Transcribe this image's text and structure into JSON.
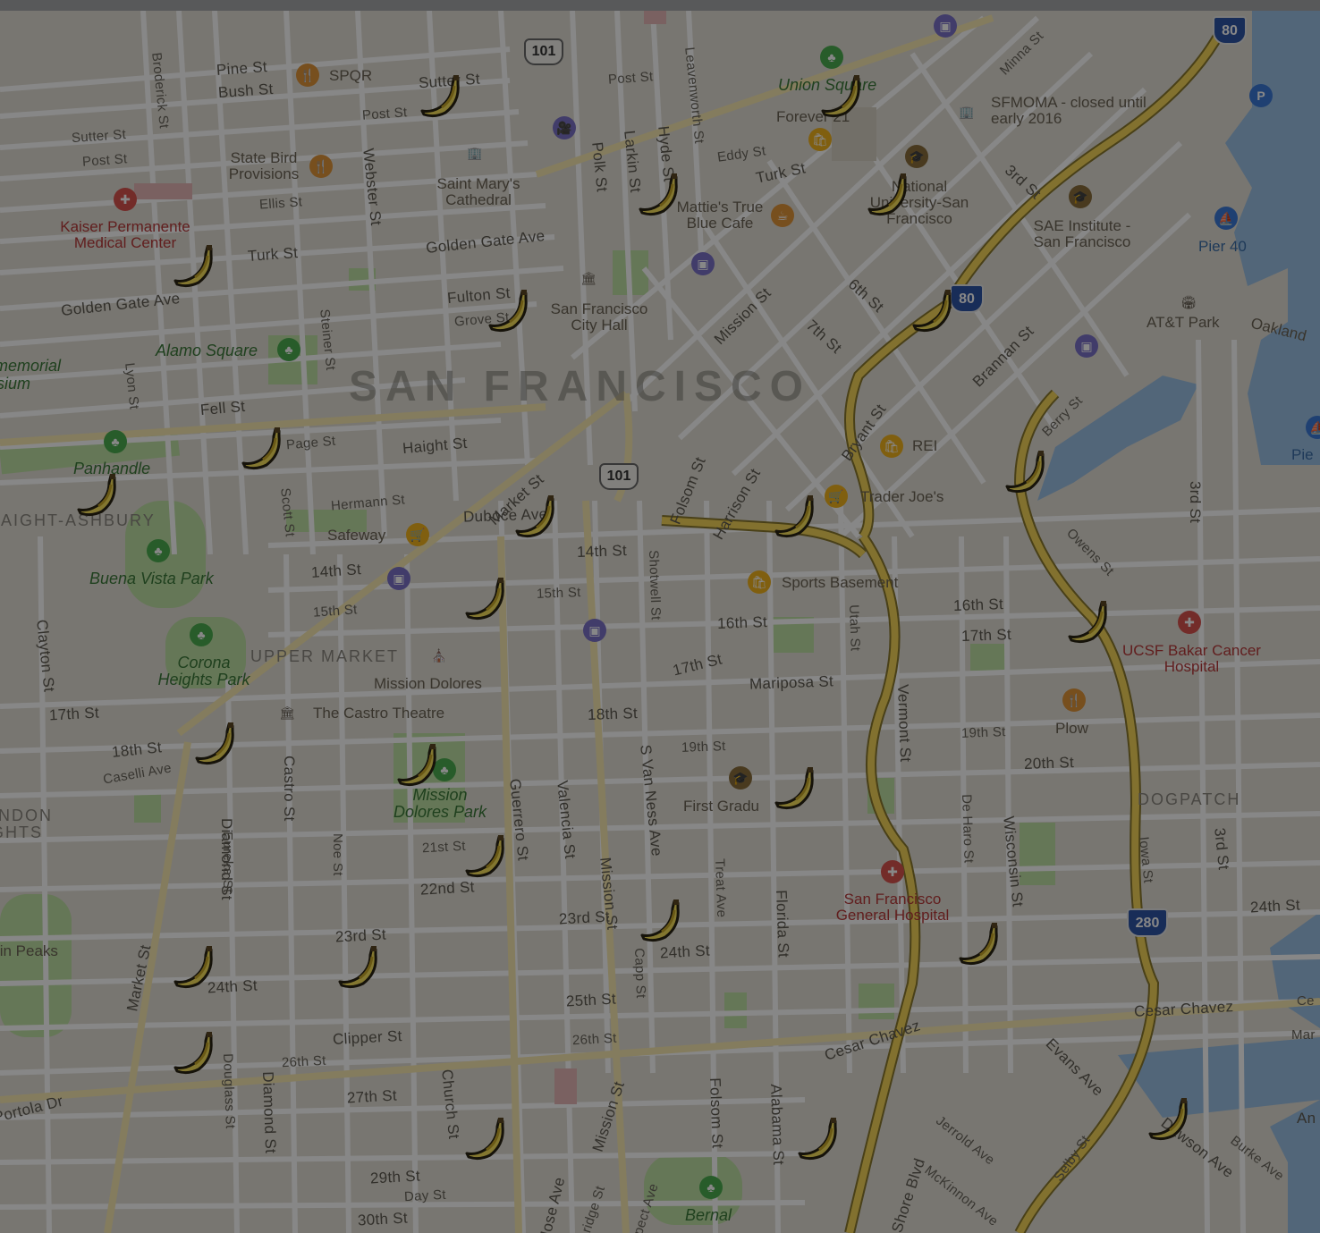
{
  "map": {
    "city_label": "SAN FRANCISCO",
    "colors": {
      "land": "#e3dfd6",
      "water": "#9cc0e4",
      "park": "#bfe0a4",
      "street": "#ffffff",
      "highway": "#f6d65a",
      "overlay": "rgba(0,0,0,0.47)"
    },
    "street_labels": [
      "Pine St",
      "Bush St",
      "Sutter St",
      "Post St",
      "Ellis St",
      "Turk St",
      "Golden Gate Ave",
      "Fell St",
      "Page St",
      "Haight St",
      "Hermann St",
      "14th St",
      "15th St",
      "17th St",
      "18th St",
      "Caselli Ave",
      "Diamond St",
      "Eureka St",
      "Castro St",
      "Noe St",
      "21st St",
      "22nd St",
      "23rd St",
      "24th St",
      "25th St",
      "26th St",
      "27th St",
      "29th St",
      "30th St",
      "Day St",
      "Clipper St",
      "Market St",
      "Duboce Ave",
      "16th St",
      "Mariposa St",
      "19th St",
      "20th St",
      "Cesar Chavez",
      "Broderick St",
      "Webster St",
      "Polk St",
      "Larkin St",
      "Hyde St",
      "Leavenworth St",
      "Eddy St",
      "Minna St",
      "Fulton St",
      "Grove St",
      "Mission St",
      "6th St",
      "7th St",
      "Brannan St",
      "Bryant St",
      "Berry St",
      "3rd St",
      "Harrison St",
      "Folsom St",
      "Shotwell St",
      "Utah St",
      "Vermont St",
      "De Haro St",
      "Wisconsin St",
      "Iowa St",
      "Owens St",
      "Valencia St",
      "Guerrero St",
      "S Van Ness Ave",
      "Treat Ave",
      "Florida St",
      "Alabama St",
      "Capp St",
      "Evans Ave",
      "Jerrold Ave",
      "McKinnon Ave",
      "Burke Ave",
      "Bay Shore Blvd",
      "Selby St",
      "Church St",
      "San Jose Ave",
      "Coleridge St",
      "Prospect Ave",
      "Douglass St",
      "Portola Dr",
      "Clayton St",
      "Lyon St",
      "Steiner St",
      "Scott St",
      "Dawson Ave"
    ],
    "parks": [
      "Union Square",
      "Alamo Square",
      "Panhandle",
      "Buena Vista Park",
      "Corona Heights Park",
      "Mission Dolores Park",
      "Bernal"
    ],
    "hospitals": [
      "Kaiser Permanente Medical Center",
      "San Francisco General Hospital",
      "UCSF Bakar Cancer Hospital"
    ],
    "pois": [
      "SPQR",
      "State Bird Provisions",
      "Saint Mary's Cathedral",
      "Forever 21",
      "SFMOMA - closed until early 2016",
      "National University-San Francisco",
      "SAE Institute - San Francisco",
      "Pier 40",
      "AT&T Park",
      "Oakland",
      "San Francisco City Hall",
      "Mattie's True Blue Cafe",
      "REI",
      "Trader Joe's",
      "Safeway",
      "Sports Basement",
      "Mission Dolores",
      "The Castro Theatre",
      "First Gradu",
      "Plow",
      "Pie",
      "memorial",
      "sium",
      "Twin Peaks",
      "Ce",
      "Mar",
      "An"
    ],
    "neighborhoods": [
      "UPPER MARKET",
      "HAIGHT-ASHBURY",
      "DOGPATCH",
      "NDON",
      "GHTS"
    ],
    "highway_shields": {
      "us101": "101",
      "i80": "80",
      "i280": "280"
    },
    "banana_marker_count": 27
  }
}
